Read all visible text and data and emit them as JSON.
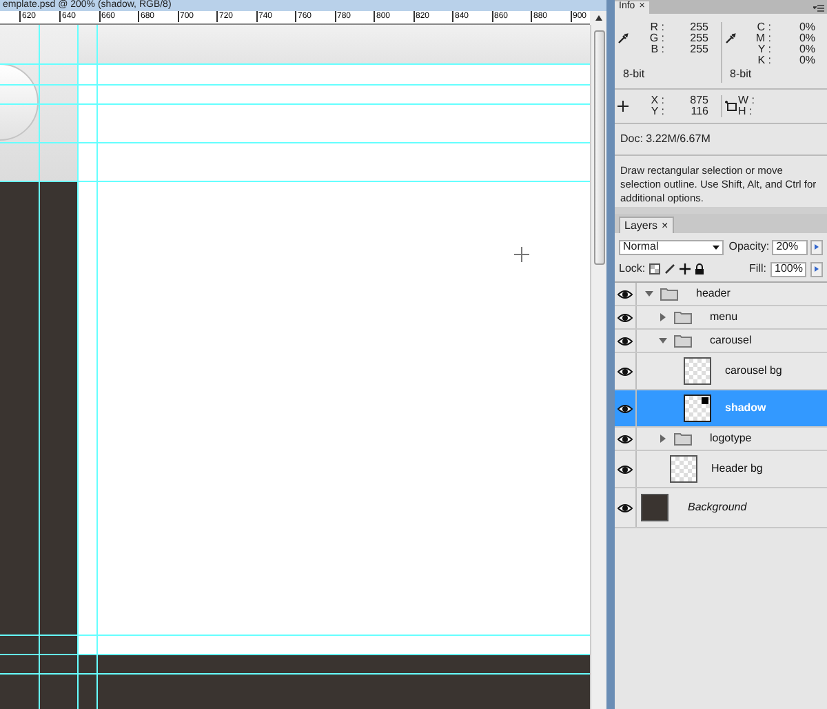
{
  "document": {
    "title": "emplate.psd @ 200% (shadow, RGB/8)",
    "ruler_labels": [
      "620",
      "640",
      "660",
      "680",
      "700",
      "720",
      "740",
      "760",
      "780",
      "800",
      "820",
      "840",
      "860",
      "880",
      "900"
    ]
  },
  "info": {
    "tab": {
      "label": "Info",
      "close": "×"
    },
    "color_left": [
      {
        "label": "R :",
        "value": "255"
      },
      {
        "label": "G :",
        "value": "255"
      },
      {
        "label": "B :",
        "value": "255"
      }
    ],
    "color_right": [
      {
        "label": "C :",
        "value": "0%"
      },
      {
        "label": "M :",
        "value": "0%"
      },
      {
        "label": "Y :",
        "value": "0%"
      },
      {
        "label": "K :",
        "value": "0%"
      }
    ],
    "bit_left": "8-bit",
    "bit_right": "8-bit",
    "position": [
      {
        "label": "X :",
        "value": "875"
      },
      {
        "label": "Y :",
        "value": "116"
      }
    ],
    "size": [
      {
        "label": "W :"
      },
      {
        "label": "H :"
      }
    ],
    "doc": "Doc: 3.22M/6.67M",
    "hint": "Draw rectangular selection or move selection outline.  Use Shift, Alt, and Ctrl for additional options."
  },
  "layers": {
    "tab": {
      "label": "Layers",
      "close": "×"
    },
    "blend_mode": "Normal",
    "opacity_label": "Opacity:",
    "opacity": "20%",
    "lock_label": "Lock:",
    "fill_label": "Fill:",
    "fill": "100%",
    "items": [
      {
        "kind": "group",
        "name": "header",
        "visible": true,
        "expanded": true,
        "selected": false,
        "children": [
          {
            "kind": "group",
            "name": "menu",
            "visible": true,
            "expanded": false,
            "selected": false
          },
          {
            "kind": "group",
            "name": "carousel",
            "visible": true,
            "expanded": true,
            "selected": false,
            "children": [
              {
                "kind": "layer",
                "name": "carousel bg",
                "visible": true,
                "selected": false,
                "has_mask": false
              },
              {
                "kind": "layer",
                "name": "shadow",
                "visible": true,
                "selected": true,
                "has_mask": true
              }
            ]
          },
          {
            "kind": "group",
            "name": "logotype",
            "visible": true,
            "expanded": false,
            "selected": false
          },
          {
            "kind": "layer",
            "name": "Header bg",
            "visible": true,
            "selected": false,
            "has_mask": false
          }
        ]
      },
      {
        "kind": "background",
        "name": "Background",
        "visible": true,
        "selected": false
      }
    ]
  }
}
